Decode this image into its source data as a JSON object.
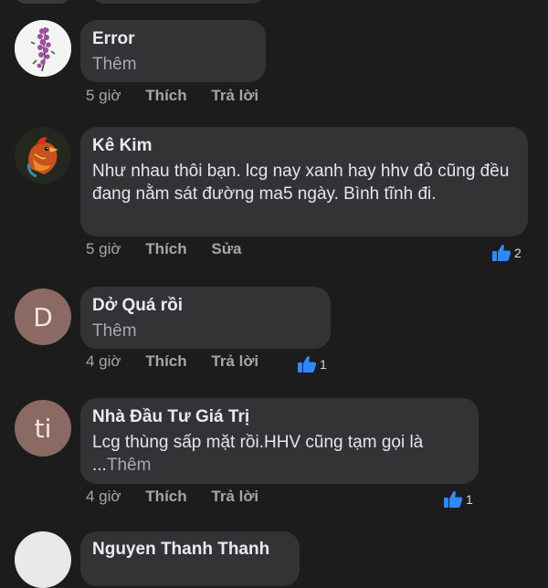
{
  "comments": [
    {
      "author": "Error",
      "text": "",
      "more": "Thêm",
      "time": "5 giờ",
      "like": "Thích",
      "action": "Trả lời",
      "reactions": ""
    },
    {
      "author": "Kê Kim",
      "text": "Như nhau thôi bạn. lcg nay xanh hay hhv đỏ cũng đều đang nằm sát đường ma5 ngày. Bình tĩnh đi.",
      "more": "",
      "time": "5 giờ",
      "like": "Thích",
      "action": "Sửa",
      "reactions": "2"
    },
    {
      "author": "Dở Quá rồi",
      "avatar_letter": "D",
      "text": "",
      "more": "Thêm",
      "time": "4 giờ",
      "like": "Thích",
      "action": "Trả lời",
      "reactions": "1"
    },
    {
      "author": "Nhà Đầu Tư Giá Trị",
      "avatar_letter": "ti",
      "text": "Lcg thùng sấp mặt rồi.HHV cũng tạm gọi là ...",
      "more": "Thêm",
      "time": "4 giờ",
      "like": "Thích",
      "action": "Trả lời",
      "reactions": "1"
    },
    {
      "author": "Nguyen Thanh Thanh"
    }
  ],
  "colors": {
    "like_blue": "#2e89ff",
    "bubble": "#333335",
    "background": "#1c1c1d"
  },
  "icons": [
    "flower-avatar-image",
    "rooster-avatar-image",
    "thumbs-up-icon"
  ]
}
